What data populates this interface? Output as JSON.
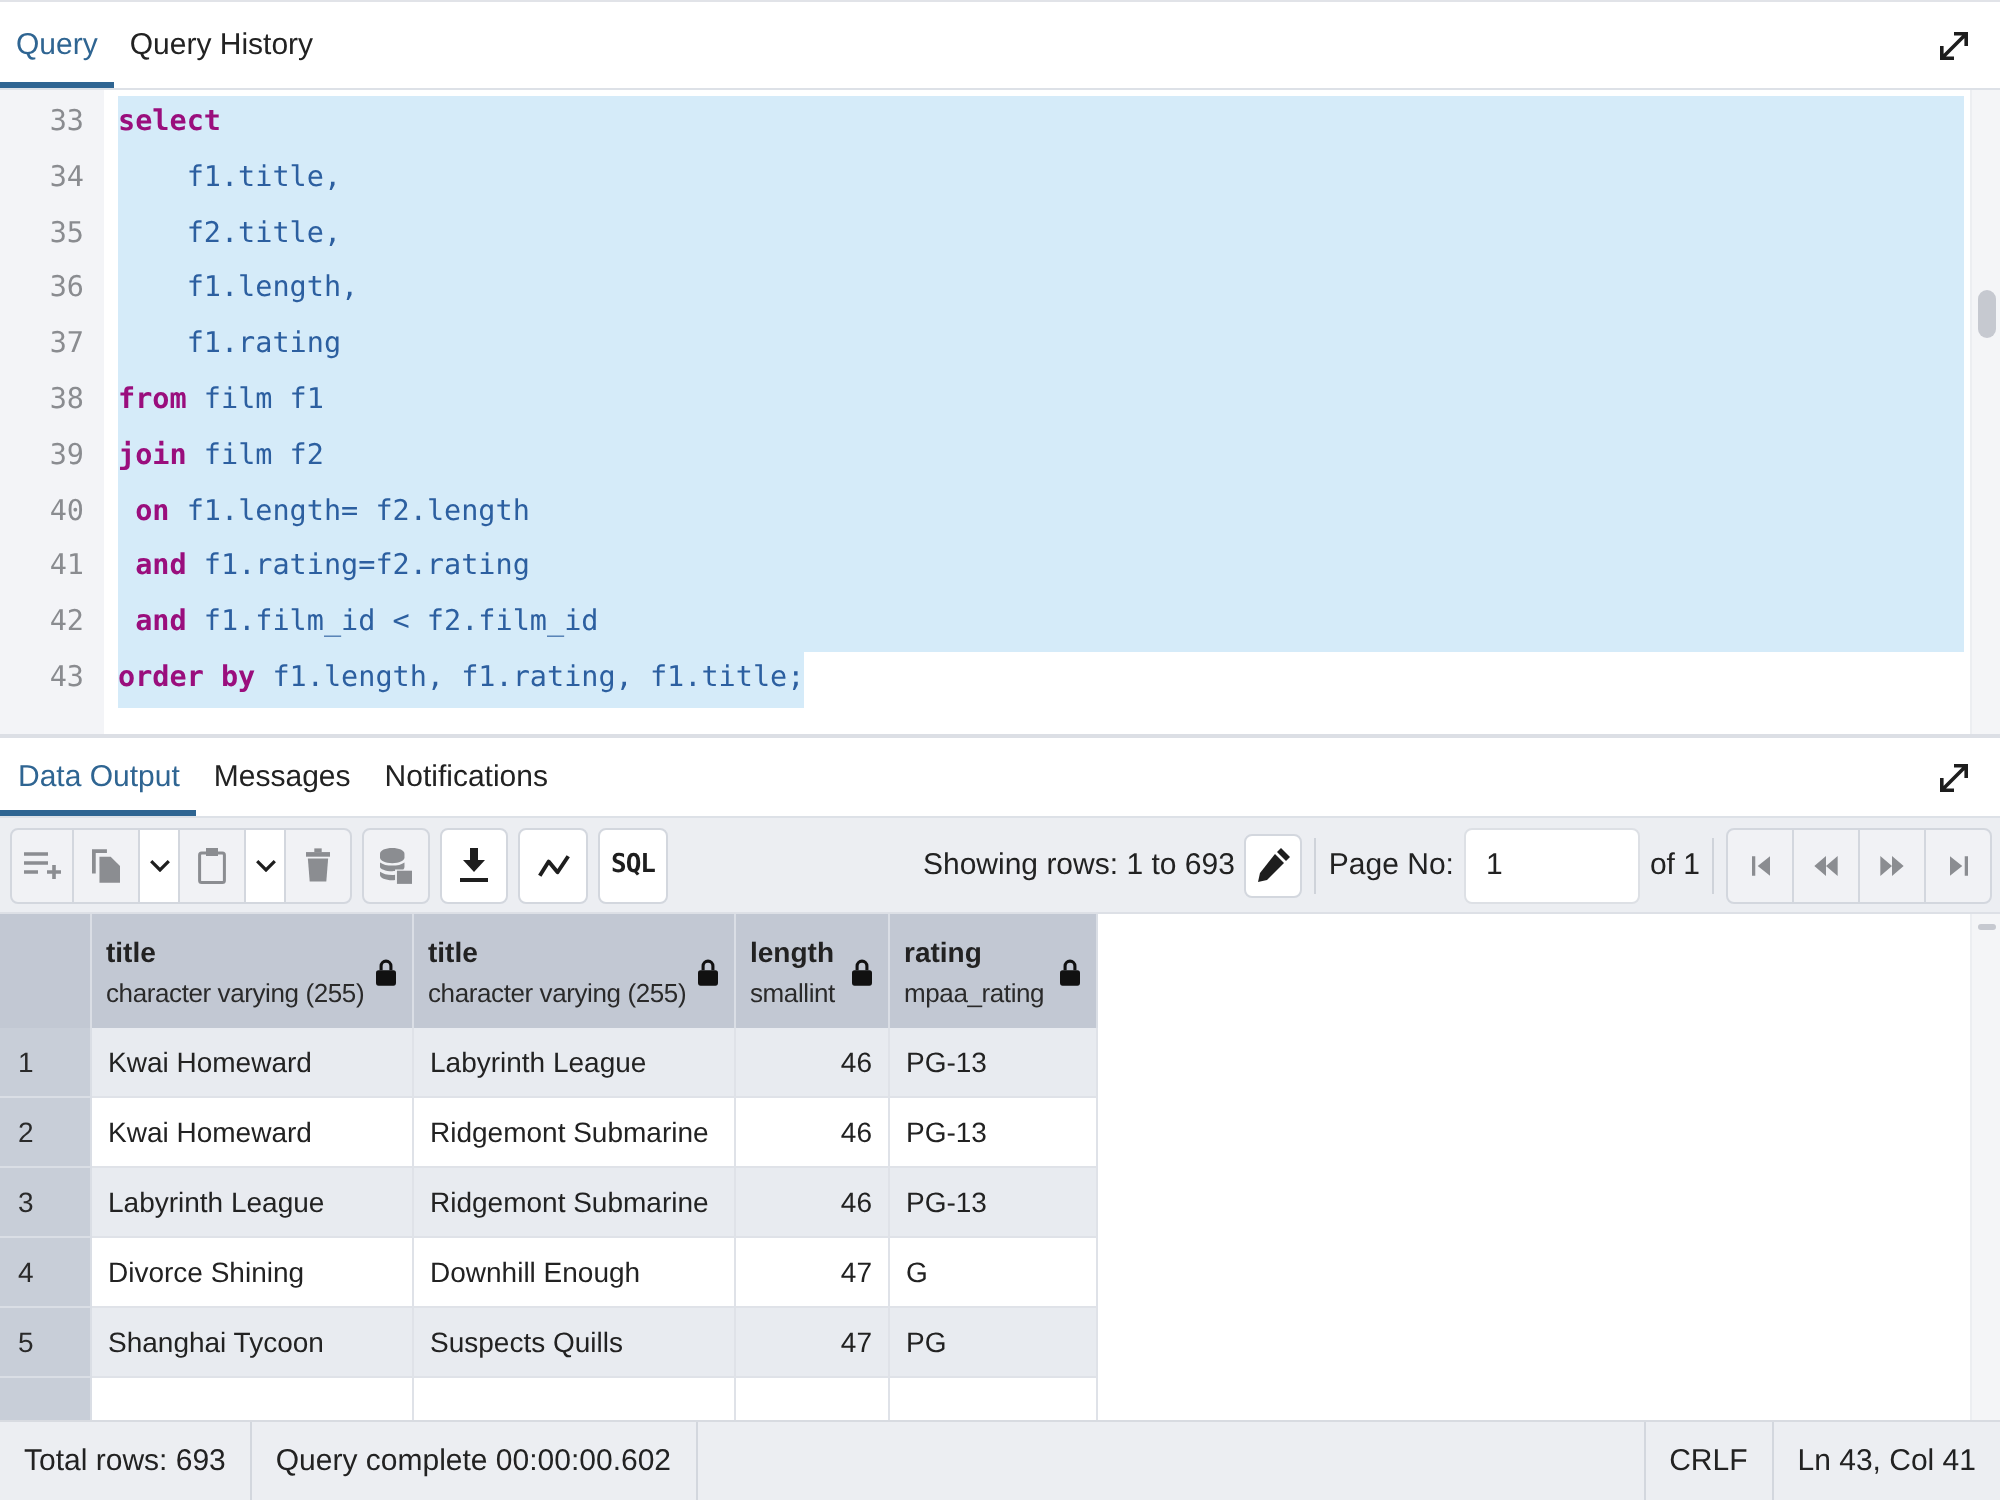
{
  "query_tabs": [
    {
      "label": "Query",
      "selected": true
    },
    {
      "label": "Query History",
      "selected": false
    }
  ],
  "editor": {
    "lines": [
      {
        "number": "33",
        "selected": true,
        "tokens": [
          {
            "kind": "keyword",
            "text": "select"
          }
        ]
      },
      {
        "number": "34",
        "selected": true,
        "tokens": [
          {
            "kind": "code",
            "text": "    f1.title,"
          }
        ]
      },
      {
        "number": "35",
        "selected": true,
        "tokens": [
          {
            "kind": "code",
            "text": "    f2.title,"
          }
        ]
      },
      {
        "number": "36",
        "selected": true,
        "tokens": [
          {
            "kind": "code",
            "text": "    f1.length,"
          }
        ]
      },
      {
        "number": "37",
        "selected": true,
        "tokens": [
          {
            "kind": "code",
            "text": "    f1.rating"
          }
        ]
      },
      {
        "number": "38",
        "selected": true,
        "tokens": [
          {
            "kind": "keyword",
            "text": "from"
          },
          {
            "kind": "code",
            "text": " film f1"
          }
        ]
      },
      {
        "number": "39",
        "selected": true,
        "tokens": [
          {
            "kind": "keyword",
            "text": "join"
          },
          {
            "kind": "code",
            "text": " film f2"
          }
        ]
      },
      {
        "number": "40",
        "selected": true,
        "tokens": [
          {
            "kind": "keyword",
            "text": " on"
          },
          {
            "kind": "code",
            "text": " f1.length= f2.length"
          }
        ]
      },
      {
        "number": "41",
        "selected": true,
        "tokens": [
          {
            "kind": "keyword",
            "text": " and"
          },
          {
            "kind": "code",
            "text": " f1.rating=f2.rating"
          }
        ]
      },
      {
        "number": "42",
        "selected": true,
        "tokens": [
          {
            "kind": "keyword",
            "text": " and"
          },
          {
            "kind": "code",
            "text": " f1.film_id < f2.film_id"
          }
        ]
      },
      {
        "number": "43",
        "selected": true,
        "tokens": [
          {
            "kind": "keyword",
            "text": "order by"
          },
          {
            "kind": "code",
            "text": " f1.length, f1.rating, f1.title;"
          }
        ]
      }
    ]
  },
  "result_tabs": [
    {
      "label": "Data Output",
      "selected": true
    },
    {
      "label": "Messages",
      "selected": false
    },
    {
      "label": "Notifications",
      "selected": false
    }
  ],
  "toolbar": {
    "add_row": {
      "disabled": true
    },
    "copy": {
      "disabled": true
    },
    "copy_menu": {
      "disabled": false
    },
    "paste": {
      "disabled": true
    },
    "paste_menu": {
      "disabled": false
    },
    "delete": {
      "disabled": true
    },
    "save_data": {
      "disabled": true
    },
    "download": {
      "disabled": false
    },
    "graph": {
      "disabled": false
    },
    "sql": {
      "label": "SQL",
      "disabled": false
    }
  },
  "pager": {
    "rows_label": "Showing rows: 1 to 693",
    "edit": {
      "disabled": false
    },
    "page_label": "Page No:",
    "page_value": "1",
    "page_count": "of 1",
    "first": {
      "disabled": true
    },
    "previous": {
      "disabled": true
    },
    "next": {
      "disabled": true
    },
    "last": {
      "disabled": true
    }
  },
  "grid": {
    "columns": [
      {
        "name": "title",
        "type": "character varying (255)",
        "locked": true,
        "kind": "text"
      },
      {
        "name": "title",
        "type": "character varying (255)",
        "locked": true,
        "kind": "text"
      },
      {
        "name": "length",
        "type": "smallint",
        "locked": true,
        "kind": "number"
      },
      {
        "name": "rating",
        "type": "mpaa_rating",
        "locked": true,
        "kind": "text"
      }
    ],
    "rows": [
      {
        "number": "1",
        "cells": [
          "Kwai Homeward",
          "Labyrinth League",
          "46",
          "PG-13"
        ]
      },
      {
        "number": "2",
        "cells": [
          "Kwai Homeward",
          "Ridgemont Submarine",
          "46",
          "PG-13"
        ]
      },
      {
        "number": "3",
        "cells": [
          "Labyrinth League",
          "Ridgemont Submarine",
          "46",
          "PG-13"
        ]
      },
      {
        "number": "4",
        "cells": [
          "Divorce Shining",
          "Downhill Enough",
          "47",
          "G"
        ]
      },
      {
        "number": "5",
        "cells": [
          "Shanghai Tycoon",
          "Suspects Quills",
          "47",
          "PG"
        ]
      }
    ]
  },
  "status_bar": {
    "total_rows": "Total rows: 693",
    "message": "Query complete 00:00:00.602",
    "line_ending": "CRLF",
    "cursor": "Ln 43, Col 41"
  }
}
